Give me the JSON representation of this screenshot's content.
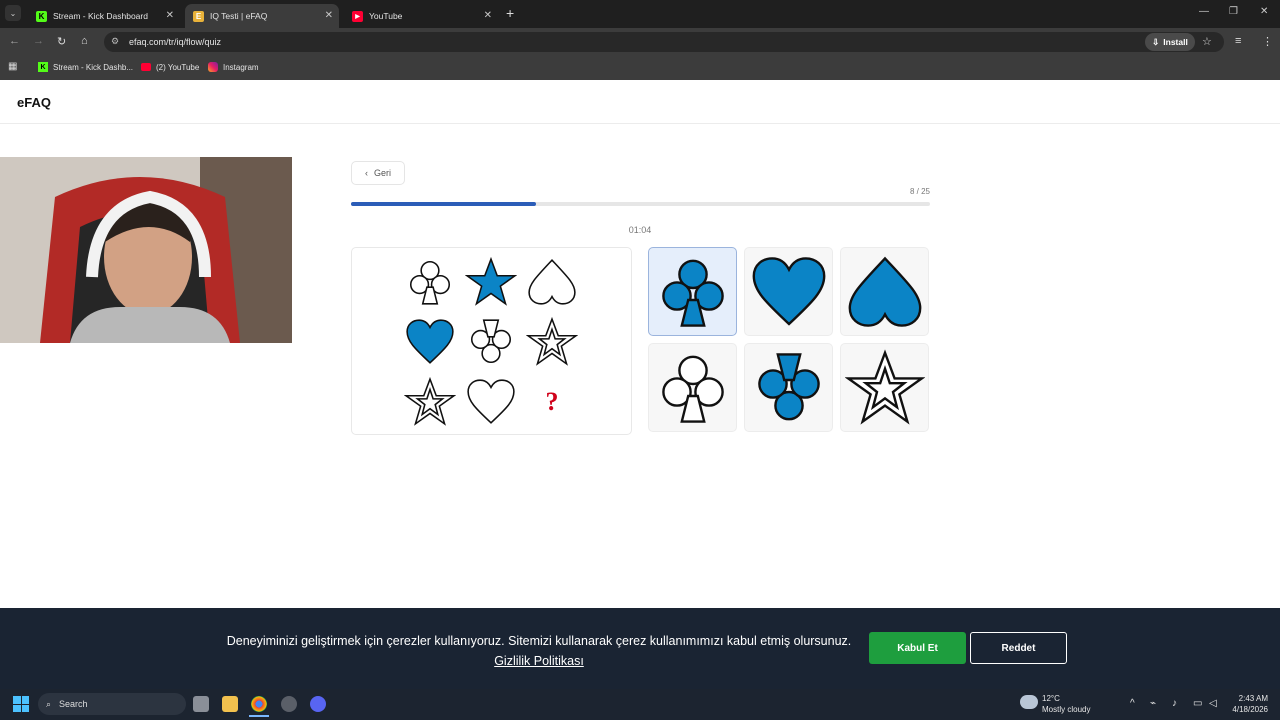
{
  "browser": {
    "tabs": [
      {
        "label": "Stream - Kick Dashboard",
        "favicon": "kick-icon",
        "active": false
      },
      {
        "label": "IQ Testi | eFAQ",
        "favicon": "efaq-icon",
        "active": true
      },
      {
        "label": "YouTube",
        "favicon": "youtube-icon",
        "active": false
      }
    ],
    "new_tab": "+",
    "url": "efaq.com/tr/iq/flow/quiz",
    "install_label": "Install",
    "bookmarks": [
      "Stream - Kick Dashb...",
      "(2) YouTube",
      "Instagram"
    ]
  },
  "site": {
    "logo": "eFAQ"
  },
  "quiz": {
    "back_label": "Geri",
    "progress_text": "8 / 25",
    "progress": 0.32,
    "timer": "01:04",
    "matrix": [
      {
        "shape": "club",
        "fill": "outline"
      },
      {
        "shape": "star",
        "fill": "blue"
      },
      {
        "shape": "spade",
        "fill": "outline"
      },
      {
        "shape": "heart",
        "fill": "blue"
      },
      {
        "shape": "club-inverted",
        "fill": "outline"
      },
      {
        "shape": "double-star",
        "fill": "outline"
      },
      {
        "shape": "double-star",
        "fill": "outline"
      },
      {
        "shape": "heart",
        "fill": "outline"
      },
      {
        "shape": "question",
        "fill": "red"
      }
    ],
    "question_mark": "?",
    "options": [
      {
        "shape": "club",
        "fill": "blue",
        "selected": true
      },
      {
        "shape": "heart",
        "fill": "blue",
        "selected": false
      },
      {
        "shape": "spade",
        "fill": "blue",
        "selected": false
      },
      {
        "shape": "club",
        "fill": "outline",
        "selected": false
      },
      {
        "shape": "club-inverted",
        "fill": "blue",
        "selected": false
      },
      {
        "shape": "double-star",
        "fill": "outline",
        "selected": false
      }
    ]
  },
  "cookie": {
    "text": "Deneyiminizi geliştirmek için çerezler kullanıyoruz. Sitemizi kullanarak çerez kullanımımızı kabul etmiş olursunuz. ",
    "link": "Gizlilik Politikası",
    "accept": "Kabul Et",
    "reject": "Reddet"
  },
  "taskbar": {
    "search": "Search",
    "weather_temp": "12°C",
    "weather_desc": "Mostly cloudy",
    "time": "2:43 AM",
    "date": "4/18/2026"
  },
  "colors": {
    "shape_blue": "#0b84c6",
    "progress": "#2b5db8",
    "accept": "#1e9e3e",
    "cookie_bg": "#1a2433",
    "question": "#d0021b"
  }
}
